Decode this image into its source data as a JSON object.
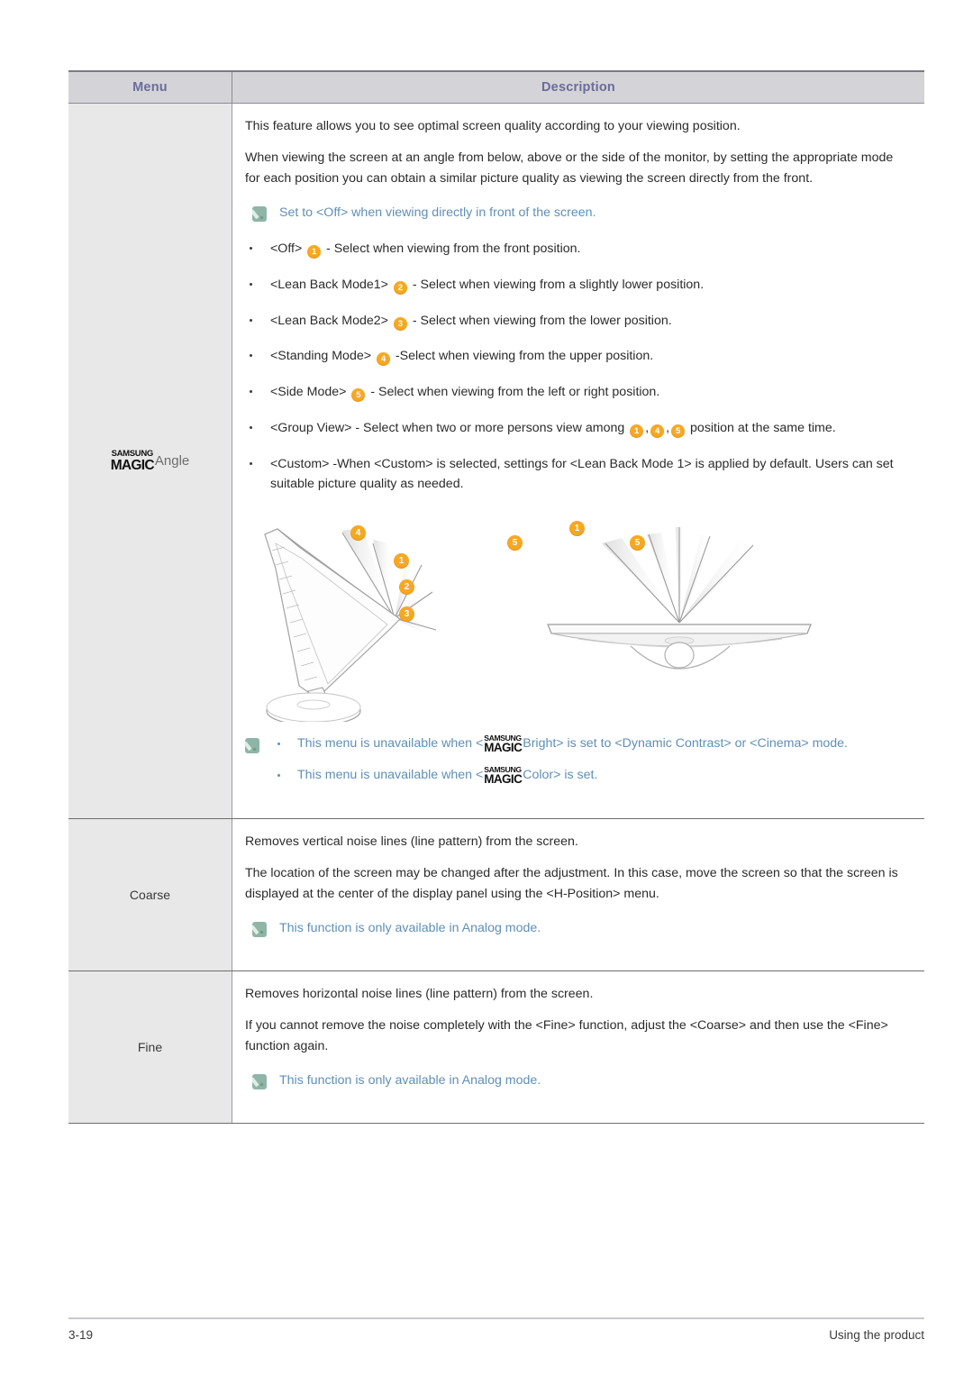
{
  "table": {
    "headers": {
      "menu": "Menu",
      "description": "Description"
    },
    "rows": [
      {
        "menu_logo": {
          "line1": "SAMSUNG",
          "line2": "MAGIC",
          "word": "Angle"
        },
        "paragraphs": [
          "This feature allows you to see optimal screen quality according to your viewing position.",
          "When viewing the screen at an angle from below, above or the side of the monitor, by setting the appropriate mode for each position you can obtain a similar picture quality as viewing the screen directly from the front."
        ],
        "note_top": "Set to <Off> when viewing directly in front of the screen.",
        "bullets": [
          {
            "label": "<Off>",
            "badge": "1",
            "text": "- Select when viewing from the front position."
          },
          {
            "label": "<Lean Back Mode1>",
            "badge": "2",
            "text": "- Select when viewing from a slightly lower position."
          },
          {
            "label": "<Lean Back Mode2>",
            "badge": "3",
            "text": "- Select when viewing from the lower position."
          },
          {
            "label": "<Standing Mode>",
            "badge": "4",
            "text": "-Select when viewing from the upper position."
          },
          {
            "label": "<Side Mode>",
            "badge": "5",
            "text": "- Select when viewing from the left or right position."
          }
        ],
        "group_view": {
          "pre": "<Group View>  - Select when two or more persons view among ",
          "badges": [
            "1",
            "4",
            "5"
          ],
          "post": " position at the same time."
        },
        "custom": " <Custom> -When <Custom> is selected, settings for <Lean Back Mode 1> is applied by default. Users can set suitable picture quality as needed.",
        "illustration": {
          "left_badges": [
            "4",
            "1",
            "2",
            "3"
          ],
          "right_badges": [
            "5",
            "1",
            "5"
          ]
        },
        "notes_bottom": [
          {
            "pre": "This menu is unavailable when <",
            "logo": {
              "line1": "SAMSUNG",
              "line2": "MAGIC"
            },
            "post": "Bright> is set to <Dynamic Contrast> or <Cinema> mode."
          },
          {
            "pre": "This menu is unavailable when <",
            "logo": {
              "line1": "SAMSUNG",
              "line2": "MAGIC"
            },
            "post": "Color> is set."
          }
        ]
      },
      {
        "menu": "Coarse",
        "paragraphs": [
          "Removes vertical noise lines (line pattern) from the screen.",
          "The location of the screen may be changed after the adjustment. In this case, move the screen so that the screen is displayed at the center of the display panel using the <H-Position> menu."
        ],
        "note": "This function is only available in Analog mode."
      },
      {
        "menu": "Fine",
        "paragraphs": [
          "Removes horizontal noise lines (line pattern) from the screen.",
          "If you cannot remove the noise completely with the <Fine> function, adjust the <Coarse> and then use the <Fine> function again."
        ],
        "note": "This function is only available in Analog mode."
      }
    ]
  },
  "footer": {
    "page_number": "3-19",
    "section": "Using the product"
  },
  "colors": {
    "badge": "#f7a823",
    "note_text": "#5f8fb8",
    "header_text": "#6b6b9e",
    "header_bg": "#d4d4d8",
    "menu_cell_bg": "#e8e8e8"
  }
}
